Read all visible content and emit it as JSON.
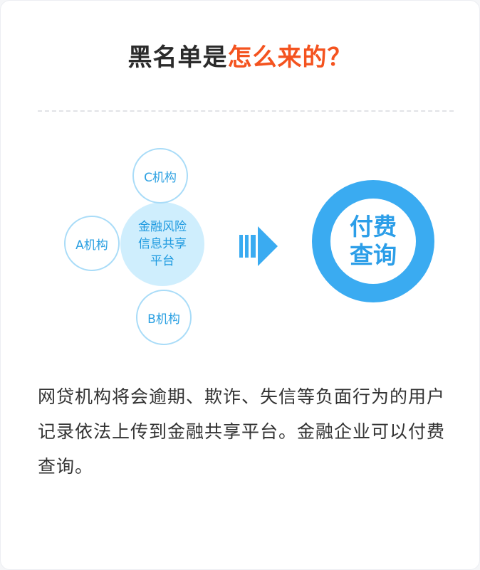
{
  "title": {
    "prefix": "黑名单是",
    "highlight": "怎么来的？"
  },
  "diagram": {
    "center_line1": "金融风险",
    "center_line2": "信息共享",
    "center_line3": "平台",
    "bubble_c": "C机构",
    "bubble_a": "A机构",
    "bubble_b": "B机构",
    "result_line1": "付费",
    "result_line2": "查询"
  },
  "description": "网贷机构将会逾期、欺诈、失信等负面行为的用户记录依法上传到金融共享平台。金融企业可以付费查询。",
  "colors": {
    "accent": "#f4531f",
    "blue": "#3aabf1",
    "light_blue": "#cfeefd"
  },
  "icons": {
    "arrow": "right-arrow-icon"
  }
}
